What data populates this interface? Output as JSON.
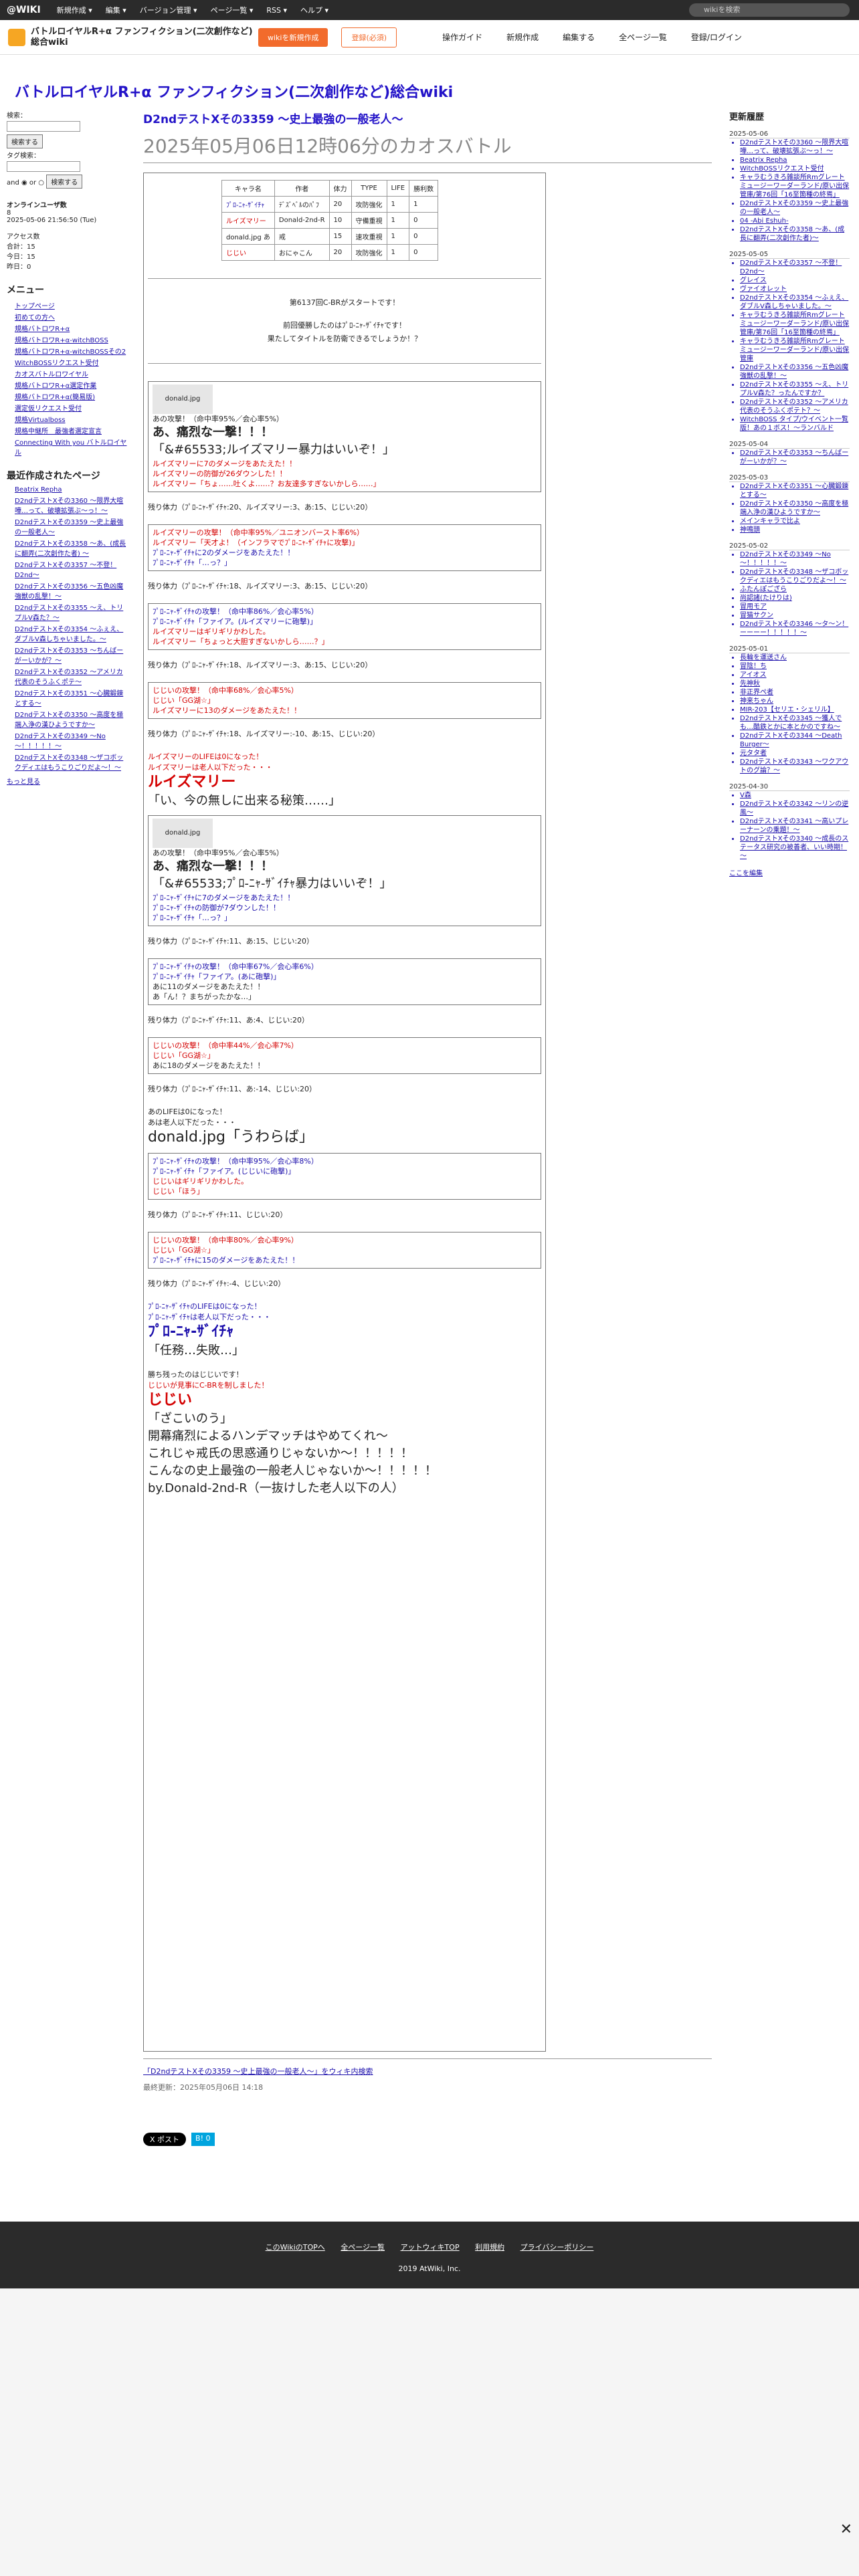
{
  "topbar": {
    "logo": "@WIKI",
    "menus": [
      "新規作成 ▾",
      "編集 ▾",
      "バージョン管理 ▾",
      "ページ一覧 ▾",
      "RSS ▾",
      "ヘルプ ▾"
    ],
    "search_placeholder": "wikiを検索"
  },
  "sitebar": {
    "site_name": "バトルロイヤルR+α ファンフィクション(二次創作など)総合wiki",
    "wiki_button": "wikiを新規作成",
    "login_button": "登録(必須)",
    "tools": [
      "操作ガイド",
      "新規作成",
      "編集する",
      "全ページ一覧",
      "登録/ログイン"
    ]
  },
  "main": {
    "wiki_title": "バトルロイヤルR+α ファンフィクション(二次創作など)総合wiki",
    "page_title": "D2ndテストXその3359 ～史上最強の一般老人～",
    "page_subtitle": "2025年05月06日12時06分のカオスバトル",
    "table_headers": [
      "キャラ名",
      "作者",
      "体力",
      "TYPE",
      "LIFE",
      "勝利数"
    ],
    "table_rows": [
      [
        "ﾌﾟﾛ-ﾆｬ-ｻﾞｲﾁｬ",
        "ﾃﾞｽﾞﾍﾞﾙのﾊﾟﾌ",
        "20",
        "攻防強化",
        "1",
        "1"
      ],
      [
        "ルイズマリー",
        "Donald-2nd-R",
        "10",
        "守備重視",
        "1",
        "0"
      ],
      [
        "donald.jpg あ",
        "戒",
        "15",
        "速攻重視",
        "1",
        "0"
      ],
      [
        "じじい",
        "おにゃこん",
        "20",
        "攻防強化",
        "1",
        "0"
      ]
    ],
    "intro": [
      "第6137回C-BRがスタートです！",
      "前回優勝したのはﾌﾟﾛ-ﾆｬ-ｻﾞｲﾁｬです！",
      "果たしてタイトルを防衛できるでしょうか！？"
    ],
    "log": [
      "あの攻撃！（命中率95%／会心率5%）",
      "あ、痛烈な一撃！！！",
      "「&#65533;ルイズマリー暴力はいいぞ！」",
      "ルイズマリーに7のダメージをあたえた！！",
      "ルイズマリーの防御が26ダウンした！！",
      "ルイズマリー「ちょ……吐くよ……？お友達多すぎないかしら……」",
      "残り体力（ﾌﾟﾛ-ﾆｬ-ｻﾞｲﾁｬ:20、ルイズマリー:3、あ:15、じじい:20）",
      "ルイズマリーの攻撃！（命中率95%／ユニオンバースト率6%）",
      "ルイズマリー「天才よ！（インフラマでﾌﾟﾛ-ﾆｬ-ｻﾞｲﾁｬに攻撃)」",
      "ﾌﾟﾛ-ﾆｬ-ｻﾞｲﾁｬに2のダメージをあたえた！！",
      "ﾌﾟﾛ-ﾆｬ-ｻﾞｲﾁｬ「…っ？」",
      "残り体力（ﾌﾟﾛ-ﾆｬ-ｻﾞｲﾁｬ:18、ルイズマリー:3、あ:15、じじい:20）",
      "ﾌﾟﾛ-ﾆｬ-ｻﾞｲﾁｬの攻撃！（命中率86%／会心率5%）",
      "ﾌﾟﾛ-ﾆｬ-ｻﾞｲﾁｬ「ファイア。(ルイズマリーに砲撃)」",
      "ルイズマリーはギリギリかわした。",
      "ルイズマリー「ちょっと大胆すぎないかしら……？」",
      "残り体力（ﾌﾟﾛ-ﾆｬ-ｻﾞｲﾁｬ:18、ルイズマリー:3、あ:15、じじい:20）",
      "じじいの攻撃！（命中率68%／会心率5%）",
      "じじい「GG湖☆」",
      "ルイズマリーに13のダメージをあたえた！！",
      "残り体力（ﾌﾟﾛ-ﾆｬ-ｻﾞｲﾁｬ:18、ルイズマリー:-10、あ:15、じじい:20）",
      "ルイズマリーのLIFEは0になった！",
      "ルイズマリーは老人以下だった・・・",
      "ルイズマリー",
      "「い、今の無しに出来る秘策……」",
      "あの攻撃！（命中率95%／会心率5%）",
      "あ、痛烈な一撃！！！",
      "「&#65533;ﾌﾟﾛ-ﾆｬ-ｻﾞｲﾁｬ暴力はいいぞ！」",
      "ﾌﾟﾛ-ﾆｬ-ｻﾞｲﾁｬに7のダメージをあたえた！！",
      "ﾌﾟﾛ-ﾆｬ-ｻﾞｲﾁｬの防御が7ダウンした！！",
      "ﾌﾟﾛ-ﾆｬ-ｻﾞｲﾁｬ「…っ？」",
      "残り体力（ﾌﾟﾛ-ﾆｬ-ｻﾞｲﾁｬ:11、あ:15、じじい:20）",
      "ﾌﾟﾛ-ﾆｬ-ｻﾞｲﾁｬの攻撃！（命中率67%／会心率6%）",
      "ﾌﾟﾛ-ﾆｬ-ｻﾞｲﾁｬ「ファイア。(あに砲撃)」",
      "あに11のダメージをあたえた！！",
      "あ「ん！？まちがったかな…」",
      "残り体力（ﾌﾟﾛ-ﾆｬ-ｻﾞｲﾁｬ:11、あ:4、じじい:20）",
      "じじいの攻撃！（命中率44%／会心率7%）",
      "じじい「GG湖☆」",
      "あに18のダメージをあたえた！！",
      "残り体力（ﾌﾟﾛ-ﾆｬ-ｻﾞｲﾁｬ:11、あ:-14、じじい:20）",
      "あのLIFEは0になった！",
      "あは老人以下だった・・・",
      "donald.jpg「うわらば」",
      "ﾌﾟﾛ-ﾆｬ-ｻﾞｲﾁｬの攻撃！（命中率95%／会心率8%）",
      "ﾌﾟﾛ-ﾆｬ-ｻﾞｲﾁｬ「ファイア。(じじいに砲撃)」",
      "じじいはギリギリかわした。",
      "じじい「ほう」",
      "残り体力（ﾌﾟﾛ-ﾆｬ-ｻﾞｲﾁｬ:11、じじい:20）",
      "じじいの攻撃！（命中率80%／会心率9%）",
      "じじい「GG湖☆」",
      "ﾌﾟﾛ-ﾆｬ-ｻﾞｲﾁｬに15のダメージをあたえた！！",
      "残り体力（ﾌﾟﾛ-ﾆｬ-ｻﾞｲﾁｬ:-4、じじい:20）",
      "ﾌﾟﾛ-ﾆｬ-ｻﾞｲﾁｬのLIFEは0になった！",
      "ﾌﾟﾛ-ﾆｬ-ｻﾞｲﾁｬは老人以下だった・・・",
      "ﾌﾟﾛ-ﾆｬ-ｻﾞｲﾁｬ",
      "「任務…失敗…」",
      "勝ち残ったのはじじいです！",
      "じじいが見事にC-BRを制しました！",
      "じじい",
      "「ざこいのう」",
      "開幕痛烈によるハンデマッチはやめてくれ～",
      "これじゃ戒氏の思惑通りじゃないか～！！！！！",
      "こんなの史上最強の一般老人じゃないか～！！！！！",
      "by.Donald-2nd-R（一抜けした老人以下の人）"
    ],
    "bottom_link": "「D2ndテストXその3359 ～史上最強の一般老人～」をウィキ内検索",
    "last_updated": "最終更新：2025年05月06日 14:18",
    "share_x": "X ポスト",
    "share_hatena": "B! 0"
  },
  "left": {
    "search_label": "検索：",
    "search_button": "検索する",
    "tag_label": "タグ検索：",
    "and_or": "and ◉ or ○",
    "tag_button": "検索する",
    "online_title": "オンラインユーザ数",
    "online_count": "8",
    "online_time": "2025-05-06 21:56:50 (Tue)",
    "access_title": "アクセス数",
    "access_lines": [
      "合計：15",
      "今日：15",
      "昨日：0"
    ],
    "menu_title": "メニュー",
    "menu_items": [
      "トップページ",
      "初めての方へ",
      "規格バトロワR+α",
      "規格バトロワR+α-witchBOSS",
      "規格バトロワR+α-witchBOSSその2",
      "WitchBOSSリクエスト受付",
      "カオスバトルロワイヤル",
      "規格バトロワR+α選定作業",
      "規格バトロワR+α(簡易版)",
      "選定仮リクエスト受付",
      "規格Virtualboss",
      "規格中継所　最強者選定宣言",
      "Connecting With you バトルロイヤル"
    ],
    "recent_title": "最近作成されたページ",
    "recent_items": [
      "Beatrix Repha",
      "D2ndテストXその3360 ～限界大喧嘩…って、破壊拡張ぶ～っ！～",
      "D2ndテストXその3359 ～史上最強の一般老人～",
      "D2ndテストXその3358 ～あ、(成長に翻弄(二次創作た者) ～",
      "D2ndテストXその3357 ～不登！D2nd～",
      "D2ndテストXその3356 ～五色凶魔 強獣の乱撃！～",
      "D2ndテストXその3355 ～え、トリプルV森た？～",
      "D2ndテストXその3354 ～ふぇえ、ダブルV森しちゃいました。～",
      "D2ndテストXその3353 ～ちんばーがーいかが？～",
      "D2ndテストXその3352 ～アメリカ代表のそうふくポテ～",
      "D2ndテストXその3351 ～心臓鍛錬とする～",
      "D2ndテストXその3350 ～高度を極端入浄の漢ひようですか～",
      "D2ndテストXその3349 ～No～！！！！！～",
      "D2ndテストXその3348 ～ザコボックディエはもうこりごりだよ～！～"
    ],
    "more": "もっと見る"
  },
  "right": {
    "title": "更新履歴",
    "groups": [
      {
        "date": "2025-05-06",
        "items": [
          "D2ndテストXその3360 ～限界大喧嘩…って、破壊拡張ぶ～っ！～",
          "Beatrix Repha",
          "WitchBOSSリクエスト受付",
          "キャラむうきろ雑談所Rmグレートミュージーワーダーランド/原い出保管庫/第76回「16至箇種の終焉」",
          "D2ndテストXその3359 ～史上最強の一般老人～",
          "04 -Abi Eshuh-",
          "D2ndテストXその3358 ～あ、(成長に翻弄(二次創作た者)～"
        ]
      },
      {
        "date": "2025-05-05",
        "items": [
          "D2ndテストXその3357 ～不登！D2nd～",
          "グレイス",
          "ヴァイオレット",
          "D2ndテストXその3354 ～ふぇえ、ダブルV森しちゃいました。～",
          "キャラむうきろ雑談所Rmグレートミュージーワーダーランド/原い出保管庫/第76回「16至箇種の終焉」",
          "キャラむうきろ雑談所Rmグレートミュージーワーダーランド/原い出保管庫",
          "D2ndテストXその3356 ～五色凶魔 強獣の乱撃！～",
          "D2ndテストXその3355 ～え、トリプルV森た？ったんですか？",
          "D2ndテストXその3352 ～アメリカ代表のそうふくポテト？～",
          "WitchBOSS タイプ/ウイベント一覧版！あの１ボス！～ランバルド"
        ]
      },
      {
        "date": "2025-05-04",
        "items": [
          "D2ndテストXその3353 ～ちんばーがーいかが？～"
        ]
      },
      {
        "date": "2025-05-03",
        "items": [
          "D2ndテストXその3351 ～心臓鍛錬とする～",
          "D2ndテストXその3350 ～高度を極端入浄の漢ひようですか～",
          "メインキャラで比よ",
          "神鳴頭"
        ]
      },
      {
        "date": "2025-05-02",
        "items": [
          "D2ndテストXその3349 ～No～！！！！！～",
          "D2ndテストXその3348 ～ザコボックディエはもうこりごりだよ～！～",
          "ふたんぽござら",
          "尚認諸(たけりは)",
          "冒用モア",
          "冒猫サクン",
          "D2ndテストXその3346 ～タ～ン！ーーーー！！！！！～"
        ]
      },
      {
        "date": "2025-05-01",
        "items": [
          "長輪を運送さん",
          "冒陰！ち",
          "アイオス",
          "先神秋",
          "非正界ぺ者",
          "神来ちゃん",
          "MIR-203【セリエ・シェリル】",
          "D2ndテストXその3345 ～獲人でも…酷鉄とかに本とかのですね～",
          "D2ndテストXその3344 ～Death Burger～",
          "元タタ者",
          "D2ndテストXその3343 ～ワクアウトのグ論？～"
        ]
      },
      {
        "date": "2025-04-30",
        "items": [
          "V森",
          "D2ndテストXその3342 ～リンの逆風～",
          "D2ndテストXその3341 ～高いプレーナーンの乗題！～",
          "D2ndテストXその3340 ～成長のステータス研究の被善者、いい時期！～"
        ]
      }
    ],
    "more": "ここを編集"
  },
  "footer": {
    "links": [
      "このWikiのTOPへ",
      "全ページ一覧",
      "アットウィキTOP",
      "利用規約",
      "プライバシーポリシー"
    ],
    "copyright": "2019 AtWiki, Inc."
  }
}
